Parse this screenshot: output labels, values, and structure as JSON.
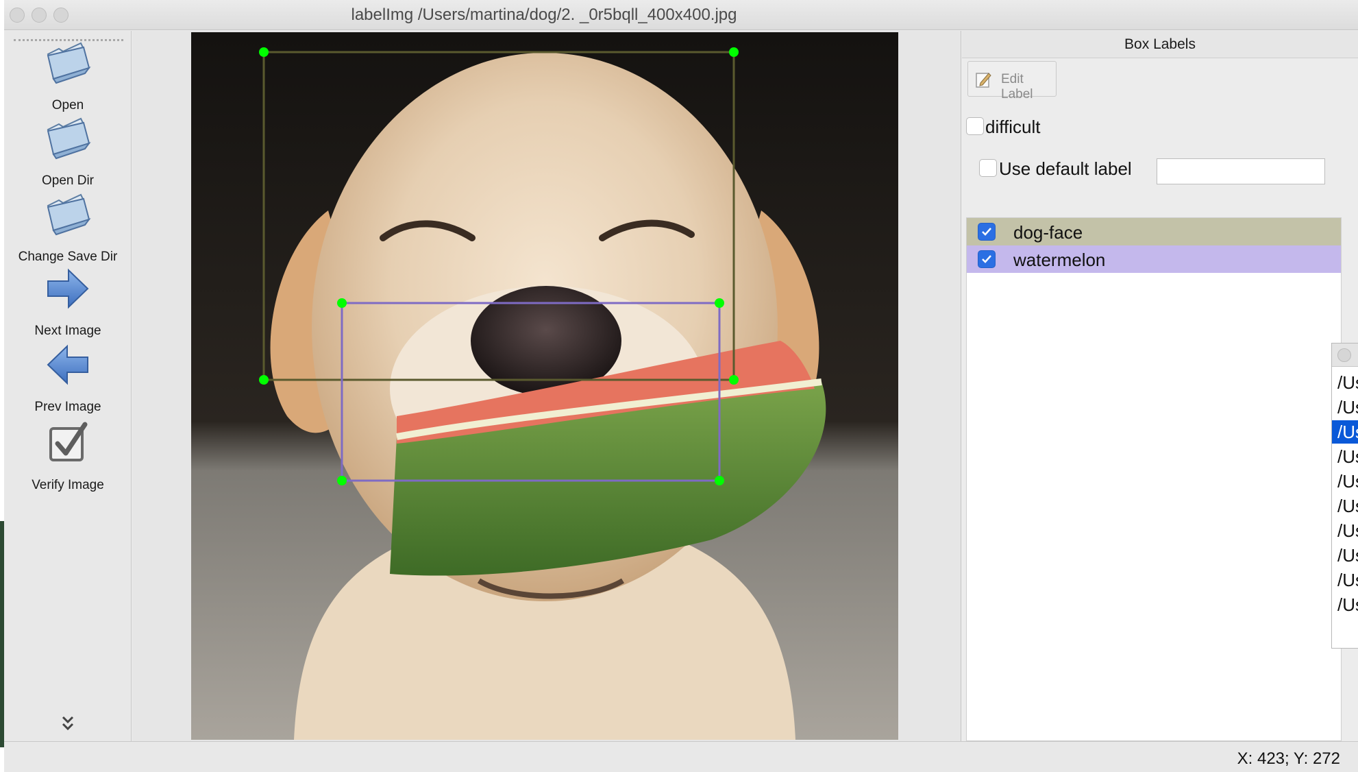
{
  "window": {
    "title": "labelImg /Users/martina/dog/2. _0r5bqll_400x400.jpg"
  },
  "toolbar": {
    "items": [
      {
        "label": "Open",
        "icon": "folder-icon"
      },
      {
        "label": "Open Dir",
        "icon": "folder-icon"
      },
      {
        "label": "Change Save Dir",
        "icon": "folder-icon"
      },
      {
        "label": "Next Image",
        "icon": "arrow-right-icon"
      },
      {
        "label": "Prev Image",
        "icon": "arrow-left-icon"
      },
      {
        "label": "Verify Image",
        "icon": "checkbox-icon"
      }
    ],
    "more_icon": "chevron-double-down-icon"
  },
  "canvas": {
    "image": "dog-holding-watermelon",
    "boxes": [
      {
        "label": "dog-face",
        "color": "#5a5a2e",
        "handle_color": "#00ff00"
      },
      {
        "label": "watermelon",
        "color": "#7e6bc4",
        "handle_color": "#00ff00"
      }
    ]
  },
  "dock": {
    "title": "Box Labels",
    "edit_label": "Edit Label",
    "difficult_label": "difficult",
    "difficult_checked": false,
    "use_default_label": "Use default label",
    "use_default_checked": false,
    "default_label_value": "",
    "labels": [
      {
        "name": "dog-face",
        "checked": true,
        "bg": "#c3c2a8"
      },
      {
        "name": "watermelon",
        "checked": true,
        "bg": "#c4b8ec"
      }
    ]
  },
  "file_list": {
    "items": [
      "/Us",
      "/Us",
      "/Us",
      "/Us",
      "/Us",
      "/Us",
      "/Us",
      "/Us",
      "/Us",
      "/Us"
    ],
    "selected_index": 2,
    "selected_color": "#0a59d8"
  },
  "status": {
    "coords": "X: 423; Y: 272"
  }
}
